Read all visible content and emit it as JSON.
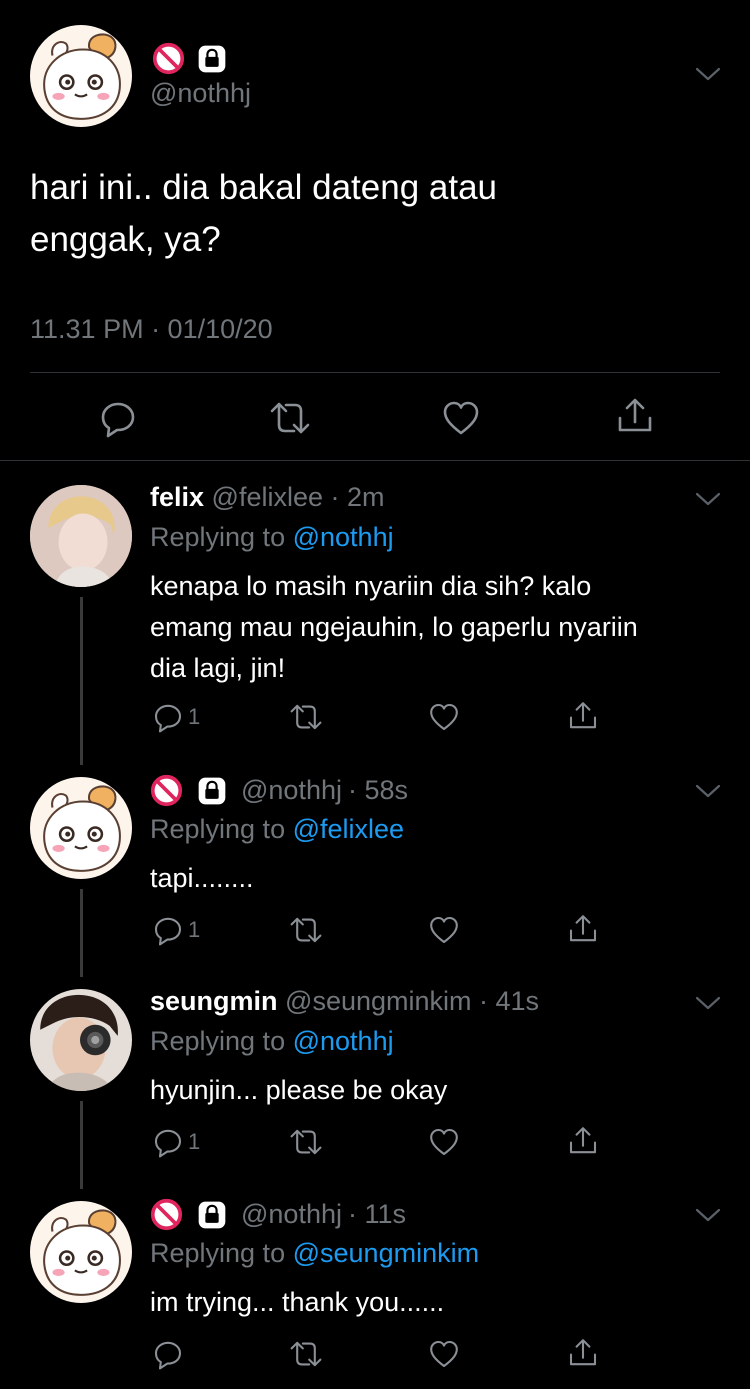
{
  "main_tweet": {
    "handle": "@nothhj",
    "text_line1": "hari ini.. dia bakal dateng atau",
    "text_line2": "enggak, ya?",
    "timestamp": "11.31 PM · 01/10/20"
  },
  "replies": [
    {
      "name": "felix",
      "handle": "@felixlee",
      "time": "· 2m",
      "replying_label": "Replying to",
      "replying_to": "@nothhj",
      "lines": [
        "kenapa lo masih nyariin dia sih? kalo",
        "emang mau ngejauhin, lo gaperlu nyariin",
        "dia lagi, jin!"
      ],
      "reply_count": "1"
    },
    {
      "name": "",
      "handle": "@nothhj",
      "time": "· 58s",
      "replying_label": "Replying to",
      "replying_to": "@felixlee",
      "lines": [
        "tapi........"
      ],
      "reply_count": "1"
    },
    {
      "name": "seungmin",
      "handle": "@seungminkim",
      "time": "· 41s",
      "replying_label": "Replying to",
      "replying_to": "@nothhj",
      "lines": [
        "hyunjin... please be okay"
      ],
      "reply_count": "1"
    },
    {
      "name": "",
      "handle": "@nothhj",
      "time": "· 11s",
      "replying_label": "Replying to",
      "replying_to": "@seungminkim",
      "lines": [
        "im trying... thank you......"
      ],
      "reply_count": ""
    }
  ],
  "icons": {
    "blocked": "no-entry-icon",
    "lock": "lock-icon",
    "reply": "speech-bubble-icon",
    "retweet": "retweet-icon",
    "like": "heart-icon",
    "share": "share-icon",
    "more": "chevron-down-icon"
  },
  "colors": {
    "background": "#000000",
    "text": "#ffffff",
    "secondary": "#71767b",
    "link": "#1d9bf0",
    "blocked": "#e0245e"
  }
}
